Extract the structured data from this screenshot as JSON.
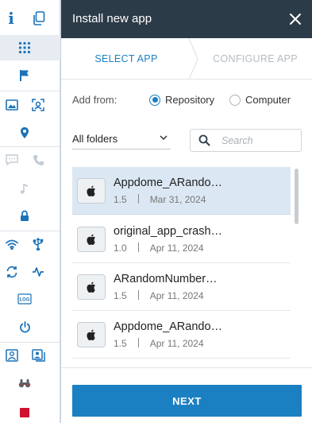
{
  "toolbar": {
    "info_glyph": "i",
    "icons": [
      "info-icon",
      "copy-icon",
      "grid-icon",
      "flag-icon",
      "image-icon",
      "face-scan-icon",
      "location-pin-icon",
      "chat-icon",
      "phone-icon",
      "music-note-icon",
      "lock-icon",
      "wifi-icon",
      "usb-icon",
      "sync-icon",
      "activity-icon",
      "log-icon",
      "power-icon",
      "contact-card-icon",
      "photo-card-icon",
      "binoculars-icon",
      "stop-icon"
    ],
    "log_label": "LOG",
    "colors": {
      "accent": "#1b72b8",
      "disabled": "#c3cbd3",
      "stop": "#d0122e"
    }
  },
  "panel": {
    "title": "Install new app",
    "steps": {
      "step1": "SELECT APP",
      "step2": "CONFIGURE APP"
    },
    "add_from_label": "Add from:",
    "sources": [
      {
        "label": "Repository",
        "selected": true
      },
      {
        "label": "Computer",
        "selected": false
      }
    ],
    "folder_select": "All folders",
    "search_placeholder": "Search",
    "apps": [
      {
        "name": "Appdome_ARando…",
        "version": "1.5",
        "date": "Mar 31, 2024",
        "selected": true
      },
      {
        "name": "original_app_crash…",
        "version": "1.0",
        "date": "Apr 11, 2024",
        "selected": false
      },
      {
        "name": "ARandomNumber…",
        "version": "1.5",
        "date": "Apr 11, 2024",
        "selected": false
      },
      {
        "name": "Appdome_ARando…",
        "version": "1.5",
        "date": "Apr 11, 2024",
        "selected": false
      }
    ],
    "next_label": "NEXT",
    "colors": {
      "header_bg": "#2c3b48",
      "primary": "#1b80c2",
      "selected_row": "#dbe8f4"
    }
  }
}
